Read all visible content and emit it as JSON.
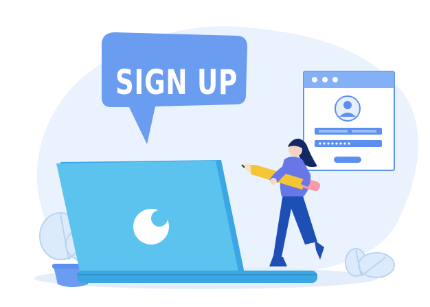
{
  "callout": {
    "title": "SIGN UP"
  },
  "form_window": {
    "dots": 3,
    "fields": [
      "name-field",
      "password-field"
    ],
    "password_mask": "••••••••",
    "icons": [
      "user-avatar-icon"
    ]
  },
  "colors": {
    "bubble": "#6a9cf0",
    "laptop_lid": "#5bc3ee",
    "laptop_edge": "#3aa6e4",
    "window_header": "#84b0f5",
    "window_border": "#5f93ee",
    "field": "#5d8ff0",
    "button": "#5d8ff0",
    "background_blob": "#eaf2fd",
    "woman_top": "#6777e8",
    "woman_pants": "#1e4fb5",
    "woman_hair": "#112a63",
    "pencil": "#f4c534",
    "eraser": "#f49aa8",
    "plant": "#cfe3f7"
  }
}
